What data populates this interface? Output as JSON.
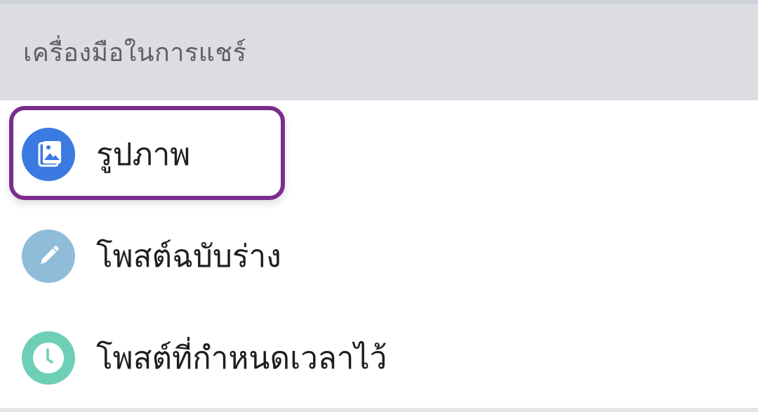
{
  "section": {
    "title": "เครื่องมือในการแชร์"
  },
  "items": [
    {
      "label": "รูปภาพ",
      "icon": "photo-gallery-icon",
      "icon_color": "#3b7ae0"
    },
    {
      "label": "โพสต์ฉบับร่าง",
      "icon": "pencil-icon",
      "icon_color": "#90bcd9"
    },
    {
      "label": "โพสต์ที่กำหนดเวลาไว้",
      "icon": "clock-icon",
      "icon_color": "#6dcfb6"
    }
  ],
  "highlight_color": "#7b2d8e"
}
